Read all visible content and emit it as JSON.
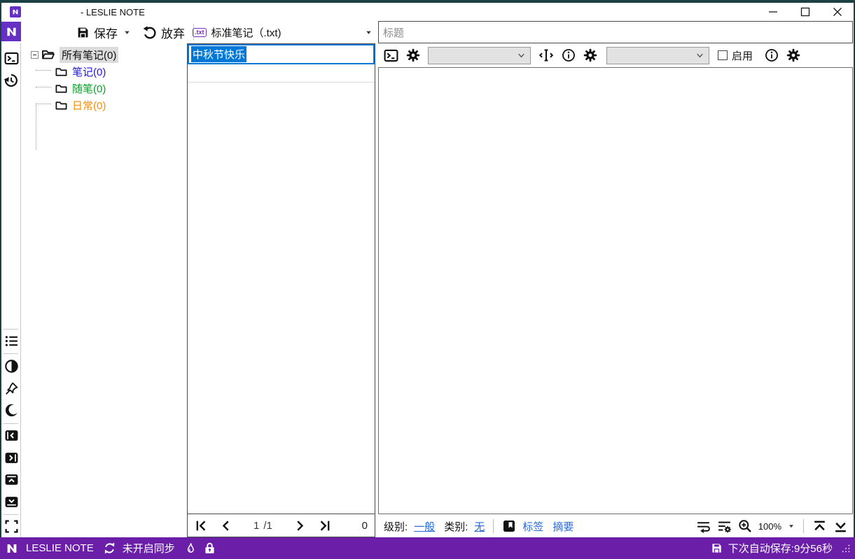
{
  "window": {
    "title": "- LESLIE NOTE"
  },
  "toolbar": {
    "save_label": "保存",
    "discard_label": "放弃"
  },
  "notetype": {
    "badge": ".txt",
    "label": "标准笔记（.txt)"
  },
  "tree": {
    "root": {
      "label": "所有笔记(0)"
    },
    "children": [
      {
        "label": "笔记(0)",
        "color": "#1F16E0"
      },
      {
        "label": "随笔(0)",
        "color": "#0AA028"
      },
      {
        "label": "日常(0)",
        "color": "#FF8C00"
      }
    ]
  },
  "list": {
    "items": [
      {
        "title": "中秋节快乐"
      }
    ]
  },
  "editor": {
    "title_placeholder": "标题",
    "enable_label": "启用"
  },
  "pagination": {
    "page": "1",
    "total": "/1",
    "count": "0"
  },
  "footer": {
    "level_label": "级别:",
    "level_value": "一般",
    "category_label": "类别:",
    "category_value": "无",
    "tags_label": "标签",
    "summary_label": "摘要",
    "zoom_value": "100%"
  },
  "statusbar": {
    "app_name": "LESLIE NOTE",
    "sync_text": "未开启同步",
    "autosave_text": "下次自动保存:9分56秒"
  },
  "icons": {
    "save": "floppy-disk",
    "discard": "undo-arrow",
    "terminal": "console-prompt",
    "history": "clock-restore",
    "list": "bullet-list",
    "contrast": "half-circle",
    "pin": "pushpin",
    "darkmode": "moon",
    "fullscreen": "corner-brackets",
    "bookmark": "tag-bookmark",
    "zoom": "magnifier-plus",
    "sync": "circular-arrows",
    "burn": "flame",
    "lock": "padlock"
  },
  "colors": {
    "frame": "#1B4145",
    "logo_purple": "#6730C4",
    "statusbar_purple": "#6B1FA8",
    "selection_blue": "#0078D7",
    "link_blue": "#2868D8",
    "folder_blue": "#1F16E0",
    "folder_green": "#0AA028",
    "folder_orange": "#FF8C00"
  }
}
